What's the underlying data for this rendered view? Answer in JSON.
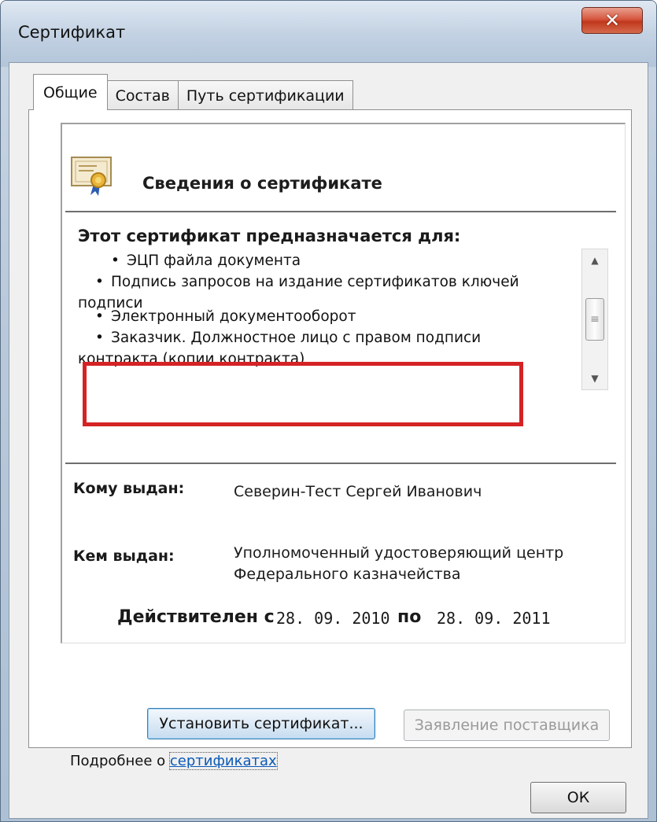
{
  "window": {
    "title": "Сертификат",
    "close_glyph": "✕"
  },
  "tabs": [
    {
      "label": "Общие",
      "active": true
    },
    {
      "label": "Состав",
      "active": false
    },
    {
      "label": "Путь сертификации",
      "active": false
    }
  ],
  "info": {
    "header_title": "Сведения о сертификате",
    "purpose_title": "Этот сертификат предназначается для:",
    "purposes": [
      "ЭЦП файла документа",
      "Подпись запросов на издание сертификатов ключей",
      "подписи",
      "Электронный документооборот",
      "Заказчик. Должностное лицо с правом подписи",
      "контракта (копии контракта)"
    ],
    "issued_to_label": "Кому выдан:",
    "issued_to_value": "Северин-Тест Сергей Иванович",
    "issued_by_label": "Кем выдан:",
    "issued_by_line1": "Уполномоченный удостоверяющий центр",
    "issued_by_line2": "Федерального казначейства",
    "valid_from_label": "Действителен с",
    "valid_from": "28. 09. 2010",
    "valid_to_label": "по",
    "valid_to": "28. 09. 2011"
  },
  "buttons": {
    "install": "Установить сертификат...",
    "statement": "Заявление поставщика",
    "ok": "ОК"
  },
  "footer": {
    "more_prefix": "Подробнее о ",
    "more_link": "сертификатах"
  },
  "colors": {
    "highlight": "#d42325",
    "link": "#0b59b7"
  },
  "icons": {
    "cert": "certificate-icon",
    "close": "close-icon",
    "scroll_up": "scroll-up-arrow-icon",
    "scroll_down": "scroll-down-arrow-icon"
  }
}
